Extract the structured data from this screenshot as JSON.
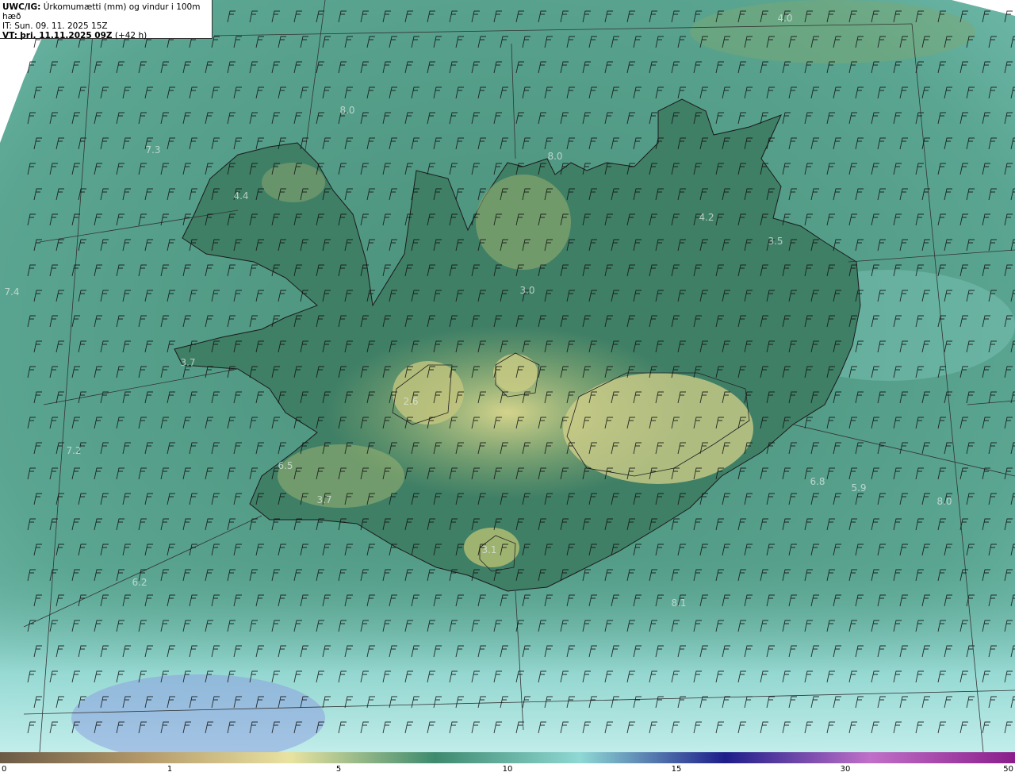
{
  "header": {
    "model": "UWC/IG:",
    "product": "Úrkomumætti (mm) og vindur i 100m hæð",
    "init_time": "IT: Sun. 09. 11. 2025 15Z",
    "valid_label": "VT:",
    "valid_time": "þri. 11.11.2025 09Z",
    "lead": "(+42 h)"
  },
  "map_values": [
    "4.0",
    "8.0",
    "7.3",
    "8.0",
    "4.4",
    "4.2",
    "3.5",
    "7.4",
    "3.0",
    "3.7",
    "2.6",
    "7.2",
    "6.5",
    "3.7",
    "6.8",
    "5.9",
    "8.0",
    "3.1",
    "6.2",
    "8.1"
  ],
  "colorbar": {
    "ticks": [
      "0",
      "1",
      "5",
      "10",
      "15",
      "30",
      "50"
    ],
    "stops": [
      "#6b5a45",
      "#b49a6a",
      "#e9e3a0",
      "#3d8a6e",
      "#8fd8d4",
      "#1d1d8a",
      "#c070c8",
      "#8a1d8a"
    ]
  },
  "colors": {
    "sea": "#4f9c88",
    "land": "#3f7f66",
    "highland": "#b8c478",
    "heavy": "#8fd8d4"
  }
}
